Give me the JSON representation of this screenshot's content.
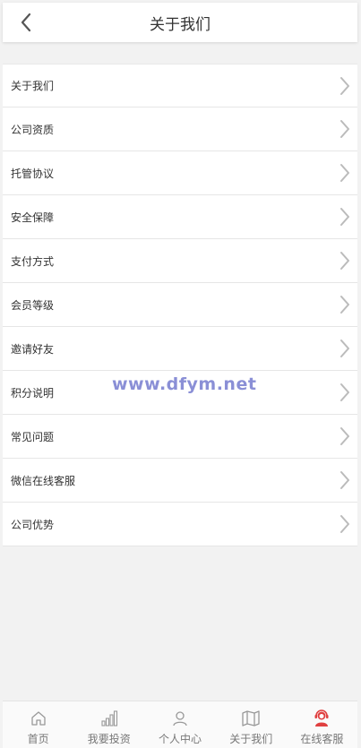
{
  "header": {
    "title": "关于我们"
  },
  "menu": {
    "items": [
      {
        "label": "关于我们"
      },
      {
        "label": "公司资质"
      },
      {
        "label": "托管协议"
      },
      {
        "label": "安全保障"
      },
      {
        "label": "支付方式"
      },
      {
        "label": "会员等级"
      },
      {
        "label": "邀请好友"
      },
      {
        "label": "积分说明"
      },
      {
        "label": "常见问题"
      },
      {
        "label": "微信在线客服"
      },
      {
        "label": "公司优势"
      }
    ]
  },
  "watermark": "www.dfym.net",
  "tabbar": {
    "items": [
      {
        "label": "首页",
        "icon": "home-icon"
      },
      {
        "label": "我要投资",
        "icon": "bar-chart-icon"
      },
      {
        "label": "个人中心",
        "icon": "user-icon"
      },
      {
        "label": "关于我们",
        "icon": "map-icon"
      },
      {
        "label": "在线客服",
        "icon": "customer-service-icon"
      }
    ]
  },
  "colors": {
    "background": "#f2f2f2",
    "chevron": "#bbbbbb",
    "service_accent": "#e04040"
  }
}
